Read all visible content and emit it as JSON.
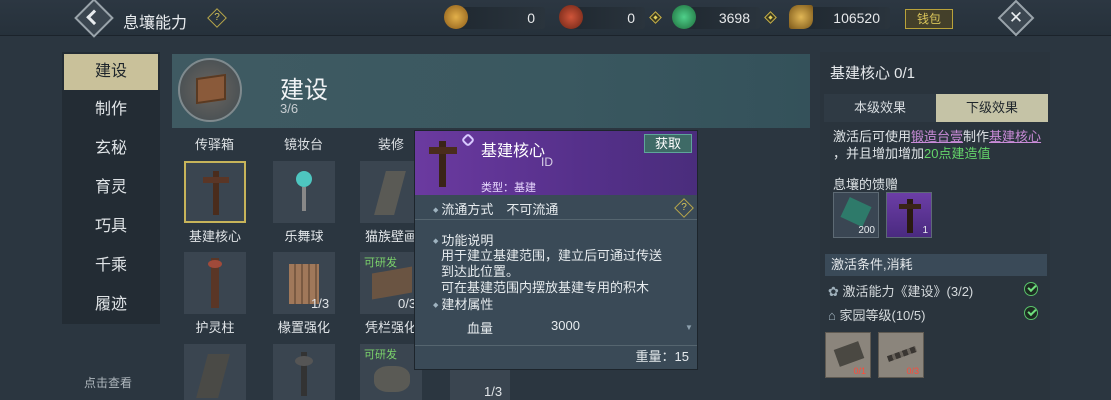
{
  "topbar": {
    "title": "息壤能力",
    "help": "?",
    "currencies": [
      {
        "icon": "gold-coin-icon",
        "value": "0",
        "color": "#c8902a"
      },
      {
        "icon": "red-gem-icon",
        "value": "0",
        "color": "#b2432e"
      },
      {
        "icon": "jade-icon",
        "value": "3698",
        "color": "#2f9a5a"
      },
      {
        "icon": "gold-ingot-icon",
        "value": "106520",
        "color": "#b88a32"
      }
    ],
    "money_button": "钱包",
    "close": "✕"
  },
  "menu": {
    "items": [
      "建设",
      "制作",
      "玄秘",
      "育灵",
      "巧具",
      "千乘",
      "履迹"
    ],
    "active": 0,
    "hint": "点击查看"
  },
  "header": {
    "title": "建设",
    "count": "3/6"
  },
  "grid": {
    "columns": [
      "传驿箱",
      "镜妆台",
      "装修"
    ],
    "items": [
      {
        "label": "基建核心",
        "tag": "",
        "frac": ""
      },
      {
        "label": "乐舞球",
        "tag": "",
        "frac": ""
      },
      {
        "label": "猫族壁画",
        "tag": "",
        "frac": ""
      },
      {
        "label": "护灵柱",
        "tag": "",
        "frac": ""
      },
      {
        "label": "椽置强化",
        "tag": "",
        "frac": "1/3"
      },
      {
        "label": "凭栏强化",
        "tag": "可研发",
        "frac": "0/3"
      },
      {
        "label": "",
        "tag": "",
        "frac": ""
      },
      {
        "label": "",
        "tag": "",
        "frac": ""
      },
      {
        "label": "",
        "tag": "可研发",
        "frac": ""
      },
      {
        "label": "",
        "tag": "",
        "frac": "1/3"
      }
    ]
  },
  "tooltip": {
    "name": "基建核心",
    "id": "ID",
    "get_button": "获取",
    "type": "类型：基建",
    "circulation": "流通方式　不可流通",
    "help": "?",
    "func_title": "功能说明",
    "func_desc1": "用于建立基建范围，建立后可通过传送",
    "func_desc2": "到达此位置。",
    "func_desc3": "可在基建范围内摆放基建专用的积木",
    "attr_title": "建材属性",
    "attr_name": "血量",
    "attr_value": "3000",
    "weight": "重量：15"
  },
  "right": {
    "title": "基建核心 0/1",
    "tabs": [
      "本级效果",
      "下级效果"
    ],
    "active_tab": 1,
    "desc_a": "激活后可使用",
    "desc_link1": "锻造台壹",
    "desc_b": "制作",
    "desc_link2": "基建核心",
    "desc_c": "，并且增加增加",
    "desc_green": "20点建造值",
    "gift_title": "息壤的馈赠",
    "rewards": [
      {
        "count": "200",
        "icon": "green-crystal-icon"
      },
      {
        "count": "1",
        "icon": "totem-icon"
      }
    ],
    "cond_title": "激活条件,消耗",
    "conditions": [
      {
        "text": "激活能力《建设》(3/2)",
        "icon": "ability-icon"
      },
      {
        "text": "家园等级(10/5)",
        "icon": "home-icon"
      }
    ],
    "materials": [
      {
        "count": "0/1",
        "icon": "stone-slab-icon"
      },
      {
        "count": "0/3",
        "icon": "chain-icon"
      }
    ]
  }
}
